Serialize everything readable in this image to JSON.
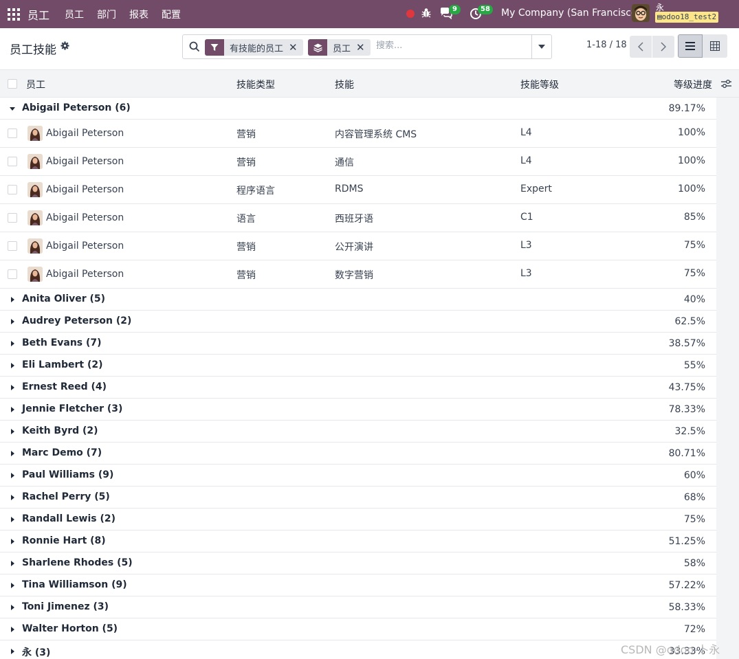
{
  "navbar": {
    "app_name": "员工",
    "menu": [
      "员工",
      "部门",
      "报表",
      "配置"
    ],
    "chat_count": "9",
    "activity_count": "58",
    "company": "My Company (San Francisco)",
    "user_name": "永",
    "database": "odoo18_test2"
  },
  "control_panel": {
    "title": "员工技能",
    "facets": [
      {
        "label": "有技能的员工",
        "icon": "filter-icon"
      },
      {
        "label": "员工",
        "icon": "group-by-icon"
      }
    ],
    "search_placeholder": "搜索...",
    "pager": "1-18 / 18"
  },
  "table": {
    "headers": {
      "employee": "员工",
      "skill_type": "技能类型",
      "skill": "技能",
      "skill_level": "技能等级",
      "progress": "等级进度"
    },
    "expanded_group": {
      "label": "Abigail Peterson (6)",
      "progress": "89.17%",
      "rows": [
        {
          "employee": "Abigail Peterson",
          "skill_type": "营销",
          "skill": "内容管理系统 CMS",
          "level": "L4",
          "progress": "100%"
        },
        {
          "employee": "Abigail Peterson",
          "skill_type": "营销",
          "skill": "通信",
          "level": "L4",
          "progress": "100%"
        },
        {
          "employee": "Abigail Peterson",
          "skill_type": "程序语言",
          "skill": "RDMS",
          "level": "Expert",
          "progress": "100%"
        },
        {
          "employee": "Abigail Peterson",
          "skill_type": "语言",
          "skill": "西班牙语",
          "level": "C1",
          "progress": "85%"
        },
        {
          "employee": "Abigail Peterson",
          "skill_type": "营销",
          "skill": "公开演讲",
          "level": "L3",
          "progress": "75%"
        },
        {
          "employee": "Abigail Peterson",
          "skill_type": "营销",
          "skill": "数字营销",
          "level": "L3",
          "progress": "75%"
        }
      ]
    },
    "collapsed_groups": [
      {
        "label": "Anita Oliver (5)",
        "progress": "40%"
      },
      {
        "label": "Audrey Peterson (2)",
        "progress": "62.5%"
      },
      {
        "label": "Beth Evans (7)",
        "progress": "38.57%"
      },
      {
        "label": "Eli Lambert (2)",
        "progress": "55%"
      },
      {
        "label": "Ernest Reed (4)",
        "progress": "43.75%"
      },
      {
        "label": "Jennie Fletcher (3)",
        "progress": "78.33%"
      },
      {
        "label": "Keith Byrd (2)",
        "progress": "32.5%"
      },
      {
        "label": "Marc Demo (7)",
        "progress": "80.71%"
      },
      {
        "label": "Paul Williams (9)",
        "progress": "60%"
      },
      {
        "label": "Rachel Perry (5)",
        "progress": "68%"
      },
      {
        "label": "Randall Lewis (2)",
        "progress": "75%"
      },
      {
        "label": "Ronnie Hart (8)",
        "progress": "51.25%"
      },
      {
        "label": "Sharlene Rhodes (5)",
        "progress": "58%"
      },
      {
        "label": "Tina Williamson (9)",
        "progress": "57.22%"
      },
      {
        "label": "Toni Jimenez (3)",
        "progress": "58.33%"
      },
      {
        "label": "Walter Horton (5)",
        "progress": "72%"
      },
      {
        "label": "永 (3)",
        "progress": "33.33%"
      }
    ]
  },
  "watermark": "CSDN @odoo-卜永",
  "colors": {
    "brand": "#714b67",
    "badge": "#28a745",
    "record": "#e0373e"
  }
}
